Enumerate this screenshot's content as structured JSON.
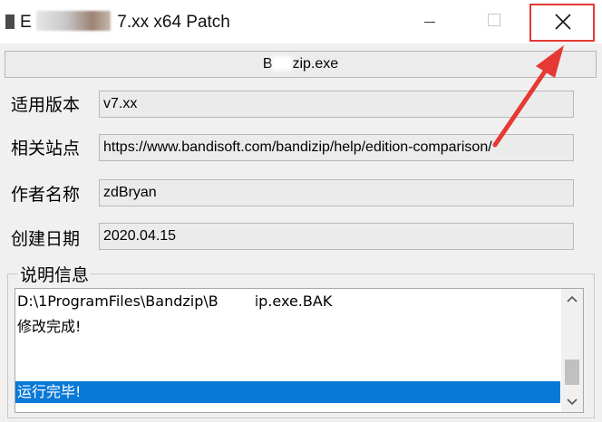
{
  "window": {
    "title": "7.xx x64 Patch",
    "title_prefix": "E",
    "minimize_icon": "minimize-icon",
    "maximize_icon": "maximize-icon",
    "close_icon": "close-icon"
  },
  "file_display": {
    "prefix": "B",
    "suffix": "zip.exe"
  },
  "fields": [
    {
      "label": "适用版本",
      "value": "v7.xx"
    },
    {
      "label": "相关站点",
      "value": "https://www.bandisoft.com/bandizip/help/edition-comparison/"
    },
    {
      "label": "作者名称",
      "value": "zdBryan"
    },
    {
      "label": "创建日期",
      "value": "2020.04.15"
    }
  ],
  "info": {
    "group_title": "说明信息",
    "lines": [
      {
        "prefix": "D:\\1ProgramFiles\\Bandzip\\B",
        "suffix": "ip.exe.BAK"
      },
      {
        "text": "修改完成!"
      },
      {
        "text": "运行完毕!"
      }
    ]
  },
  "colors": {
    "selection": "#0a78d7",
    "annotation_red": "#e53935",
    "window_bg": "#f0f0f0"
  },
  "annotation": {
    "arrow_target": "close-button"
  }
}
